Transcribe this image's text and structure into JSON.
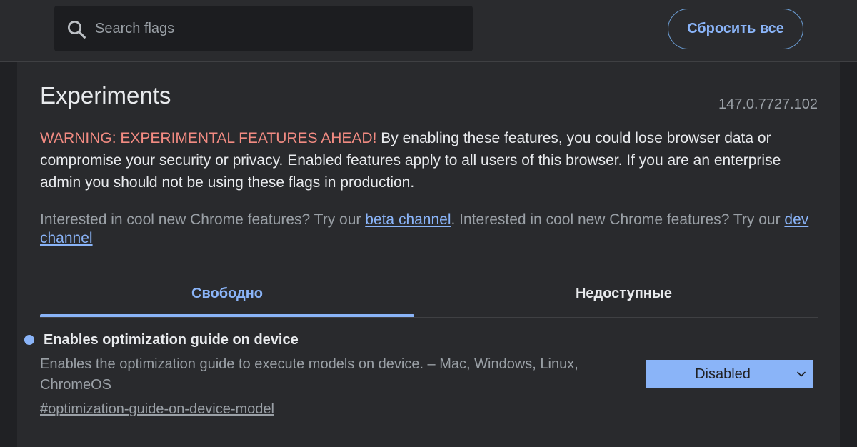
{
  "header": {
    "search_placeholder": "Search flags",
    "reset_label": "Сбросить все"
  },
  "main": {
    "title": "Experiments",
    "version": "147.0.7727.102",
    "warning_label": "WARNING: EXPERIMENTAL FEATURES AHEAD!",
    "warning_text": " By enabling these features, you could lose browser data or compromise your security or privacy. Enabled features apply to all users of this browser. If you are an enterprise admin you should not be using these flags in production.",
    "interest_text_1": "Interested in cool new Chrome features? Try our ",
    "beta_link": "beta channel",
    "interest_text_2": ". Interested in cool new Chrome features? Try our ",
    "dev_link": "dev channel"
  },
  "tabs": [
    {
      "label": "Свободно",
      "selected": true
    },
    {
      "label": "Недоступные",
      "selected": false
    }
  ],
  "experiment": {
    "title": "Enables optimization guide on device",
    "description": "Enables the optimization guide to execute models on device. – Mac, Windows, Linux, ChromeOS",
    "permalink": "#optimization-guide-on-device-model",
    "selected_value": "Disabled"
  },
  "icons": {
    "search": "search-icon",
    "chevron": "chevron-down-icon",
    "bullet": "bullet-dot-icon"
  },
  "colors": {
    "accent": "#8ab4f8",
    "warning": "#f28b82",
    "background": "#202124",
    "panel": "#292a2d",
    "text": "#e8eaed",
    "secondary_text": "#9aa0a6"
  }
}
